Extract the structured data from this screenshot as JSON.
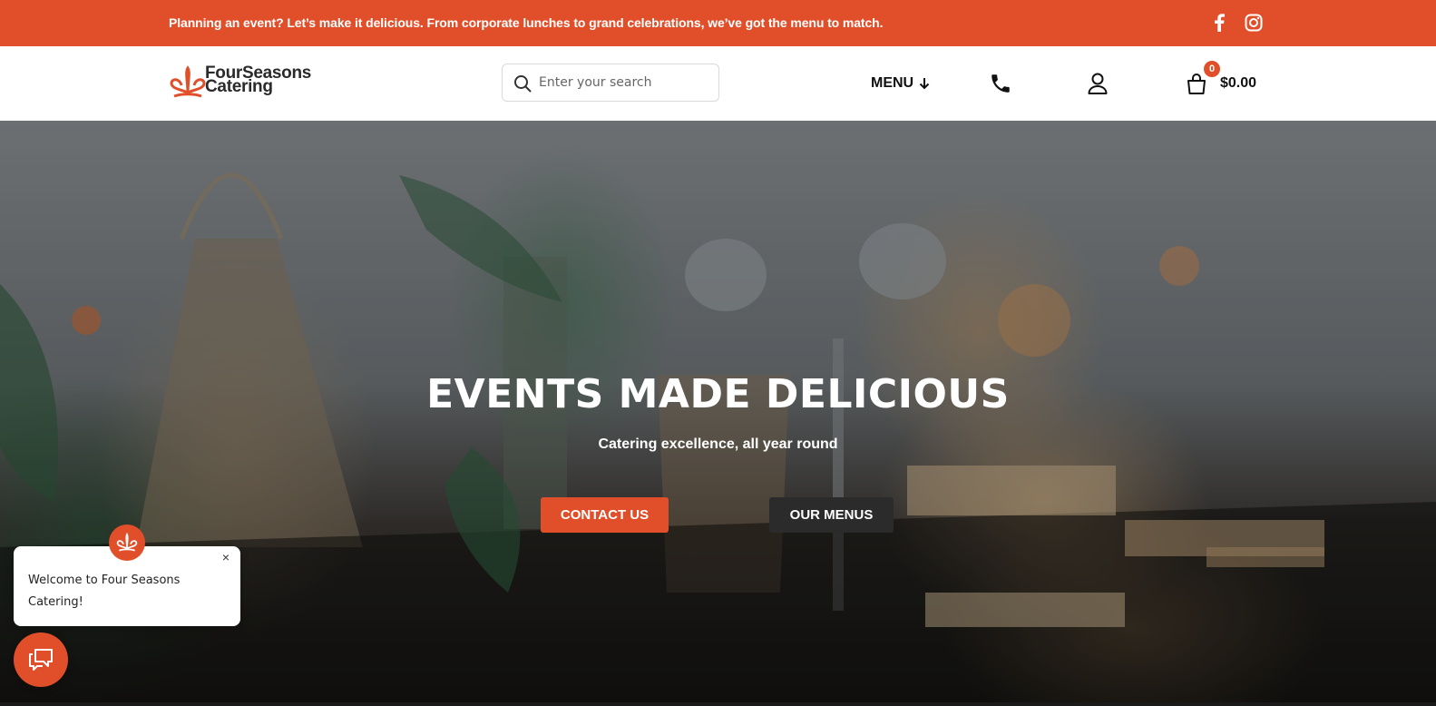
{
  "announcement": {
    "text": "Planning an event? Let’s make it delicious. From corporate lunches to grand celebrations, we’ve got the menu to match.",
    "socials": [
      {
        "icon": "facebook-icon"
      },
      {
        "icon": "instagram-icon"
      }
    ]
  },
  "header": {
    "logo": {
      "line1": "FourSeasons",
      "line2": "Catering"
    },
    "search": {
      "placeholder": "Enter your search",
      "value": ""
    },
    "menu_label": "MENU",
    "cart": {
      "count": "0",
      "total": "$0.00"
    }
  },
  "hero": {
    "title": "EVENTS MADE DELICIOUS",
    "subtitle": "Catering excellence, all year round",
    "buttons": {
      "contact": "CONTACT US",
      "menus": "OUR MENUS"
    }
  },
  "chat": {
    "message": "Welcome to Four Seasons Catering!",
    "close": "×"
  },
  "colors": {
    "accent": "#e14f2a",
    "dark_button": "#2b2b2b",
    "text_dark": "#111111"
  }
}
